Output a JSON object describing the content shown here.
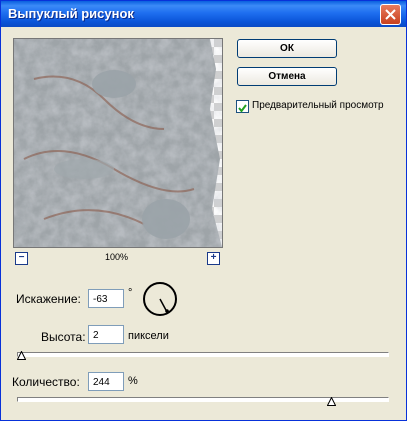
{
  "window": {
    "title": "Выпуклый рисунок"
  },
  "preview": {
    "zoom": "100%"
  },
  "buttons": {
    "ok": "ОК",
    "cancel": "Отмена"
  },
  "preview_checkbox": {
    "label": "Предварительный просмотр",
    "checked": true
  },
  "angle": {
    "label": "Искажение:",
    "value": "-63",
    "unit": "°"
  },
  "height": {
    "label": "Высота:",
    "value": "2",
    "unit": "пиксели",
    "slider_fraction": 0.0
  },
  "amount": {
    "label": "Количество:",
    "value": "244",
    "unit": "%",
    "slider_fraction": 0.86
  }
}
